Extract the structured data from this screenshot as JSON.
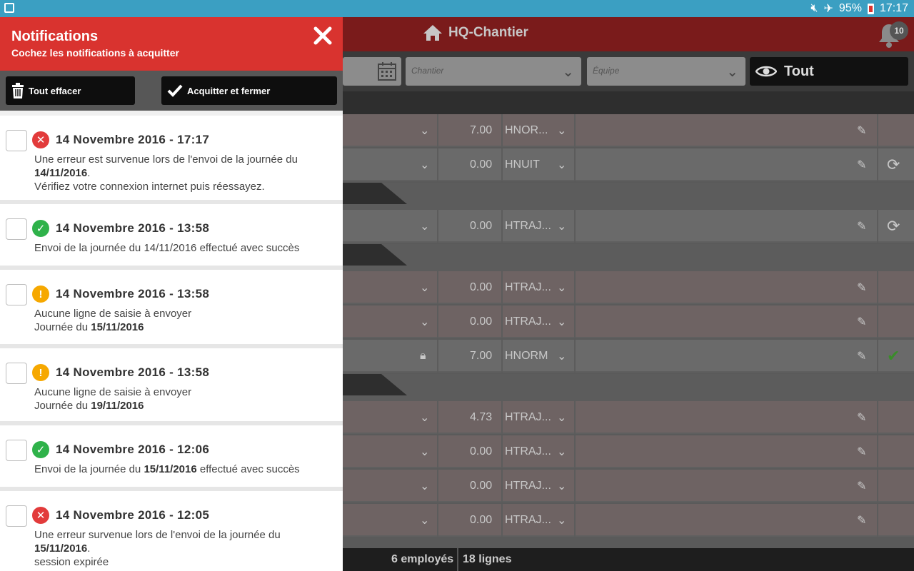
{
  "status_bar": {
    "battery": "95%",
    "time": "17:17"
  },
  "app": {
    "title": "HQ-Chantier",
    "notification_count": "10",
    "filters": {
      "chantier_placeholder": "Chantier",
      "equipe_placeholder": "Équipe",
      "view_label": "Tout"
    },
    "rows": [
      {
        "hours": "7.00",
        "code": "HNOR..."
      },
      {
        "hours": "0.00",
        "code": "HNUIT"
      },
      {
        "hours": "0.00",
        "code": "HTRAJ..."
      },
      {
        "hours": "0.00",
        "code": "HTRAJ..."
      },
      {
        "hours": "0.00",
        "code": "HTRAJ..."
      },
      {
        "hours": "7.00",
        "code": "HNORM"
      },
      {
        "hours": "4.73",
        "code": "HTRAJ..."
      },
      {
        "hours": "0.00",
        "code": "HTRAJ..."
      },
      {
        "hours": "0.00",
        "code": "HTRAJ..."
      },
      {
        "hours": "0.00",
        "code": "HTRAJ..."
      }
    ],
    "footer": {
      "employees": "6 employés",
      "lines": "18 lignes"
    }
  },
  "drawer": {
    "title": "Notifications",
    "subtitle": "Cochez les notifications à acquitter",
    "clear_all_label": "Tout effacer",
    "ack_close_label": "Acquitter et fermer",
    "notifications": [
      {
        "type": "error",
        "date": "14 Novembre 2016 - 17:17",
        "line1": "Une erreur est survenue lors de l'envoi de la journée du",
        "line1_bold": "14/11/2016",
        "line1_tail": ".",
        "line2": "Vérifiez votre connexion internet puis réessayez."
      },
      {
        "type": "success",
        "date": "14 Novembre 2016 - 13:58",
        "line1": "Envoi de la journée du 14/11/2016 effectué avec succès"
      },
      {
        "type": "warning",
        "date": "14 Novembre 2016 - 13:58",
        "line1": "Aucune ligne de saisie à envoyer",
        "line2_prefix": "Journée du",
        "line2_bold": "15/11/2016"
      },
      {
        "type": "warning",
        "date": "14 Novembre 2016 - 13:58",
        "line1": "Aucune ligne de saisie à envoyer",
        "line2_prefix": "Journée du",
        "line2_bold": "19/11/2016"
      },
      {
        "type": "success",
        "date": "14 Novembre 2016 - 12:06",
        "line1_prefix": "Envoi de la journée du",
        "line1_bold": "15/11/2016",
        "line1_tail": "effectué avec succès"
      },
      {
        "type": "error",
        "date": "14 Novembre 2016 - 12:05",
        "line1": "Une erreur survenue lors de l'envoi de la journée du",
        "line1_bold": "15/11/2016",
        "line1_tail": ".",
        "line2": "session expirée"
      }
    ]
  }
}
